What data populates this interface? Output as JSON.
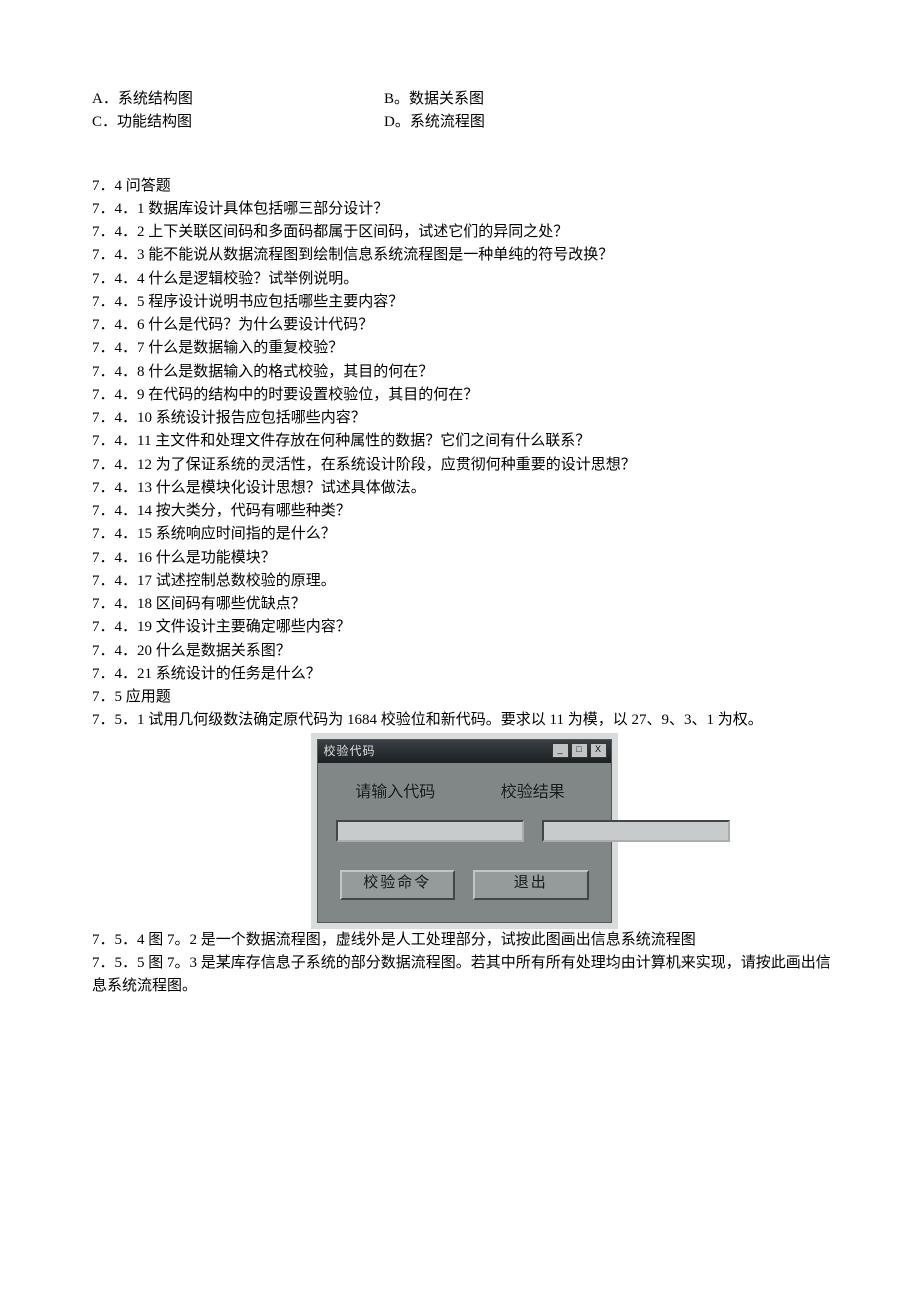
{
  "mc": {
    "A": {
      "letter": "A．",
      "text": "系统结构图"
    },
    "B": {
      "letter": "B。",
      "text": "数据关系图"
    },
    "C": {
      "letter": "C．",
      "text": "功能结构图"
    },
    "D": {
      "letter": "D。",
      "text": "系统流程图"
    }
  },
  "questions_header": "7．4 问答题",
  "q": [
    "7．4．1 数据库设计具体包括哪三部分设计？",
    "7．4．2 上下关联区间码和多面码都属于区间码，试述它们的异同之处？",
    "7．4．3 能不能说从数据流程图到绘制信息系统流程图是一种单纯的符号改换？",
    "7．4．4 什么是逻辑校验？试举例说明。",
    "7．4．5 程序设计说明书应包括哪些主要内容？",
    "7．4．6 什么是代码？为什么要设计代码？",
    "7．4．7 什么是数据输入的重复校验？",
    "7．4．8 什么是数据输入的格式校验，其目的何在？",
    "7．4．9 在代码的结构中的时要设置校验位，其目的何在？",
    "7．4．10 系统设计报告应包括哪些内容？",
    "7．4．11 主文件和处理文件存放在何种属性的数据？它们之间有什么联系？",
    "7．4．12 为了保证系统的灵活性，在系统设计阶段，应贯彻何种重要的设计思想？",
    "7．4．13 什么是模块化设计思想？试述具体做法。",
    "7．4．14 按大类分，代码有哪些种类？",
    "7．4．15 系统响应时间指的是什么？",
    "7．4．16 什么是功能模块？",
    "7．4．17 试述控制总数校验的原理。",
    "7．4．18 区间码有哪些优缺点？",
    "7．4．19 文件设计主要确定哪些内容？",
    "7．4．20 什么是数据关系图？",
    "7．4．21 系统设计的任务是什么？"
  ],
  "apply_header": "7．5 应用题",
  "apply": [
    "7．5．1 试用几何级数法确定原代码为 1684 校验位和新代码。要求以 11 为模，以 27、9、3、1 为权。",
    "7．5．4 图 7。2 是一个数据流程图，虚线外是人工处理部分，试按此图画出信息系统流程图",
    "7．5．5 图 7。3 是某库存信息子系统的部分数据流程图。若其中所有所有处理均由计算机来实现，请按此画出信息系统流程图。"
  ],
  "app": {
    "title": "校验代码",
    "win": {
      "min": "_",
      "max": "□",
      "close": "X"
    },
    "label_input": "请输入代码",
    "label_result": "校验结果",
    "input_value": "",
    "result_value": "",
    "btn_verify": "校验命令",
    "btn_exit": "退出"
  }
}
